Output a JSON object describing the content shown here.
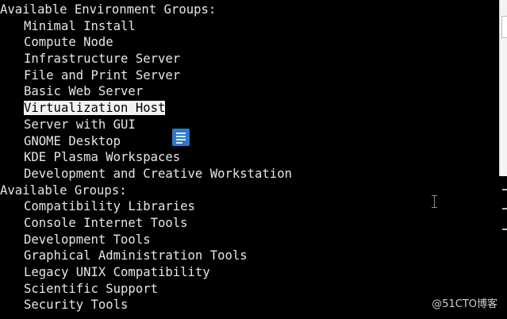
{
  "terminal": {
    "env_header": "Available Environment Groups:",
    "env_groups": [
      "Minimal Install",
      "Compute Node",
      "Infrastructure Server",
      "File and Print Server",
      "Basic Web Server",
      "Virtualization Host",
      "Server with GUI",
      "GNOME Desktop",
      "KDE Plasma Workspaces",
      "Development and Creative Workstation"
    ],
    "highlighted_item": "Virtualization Host",
    "groups_header": "Available Groups:",
    "groups": [
      "Compatibility Libraries",
      "Console Internet Tools",
      "Development Tools",
      "Graphical Administration Tools",
      "Legacy UNIX Compatibility",
      "Scientific Support",
      "Security Tools"
    ]
  },
  "overlay": {
    "document_icon": "document-icon",
    "cursor_icon": "text-cursor-icon",
    "watermark": "@51CTO博客"
  },
  "colors": {
    "background": "#000000",
    "text": "#e6e6e6",
    "selection_bg": "#f2f2f2",
    "selection_text": "#000000",
    "icon_blue": "#2b79c8"
  }
}
